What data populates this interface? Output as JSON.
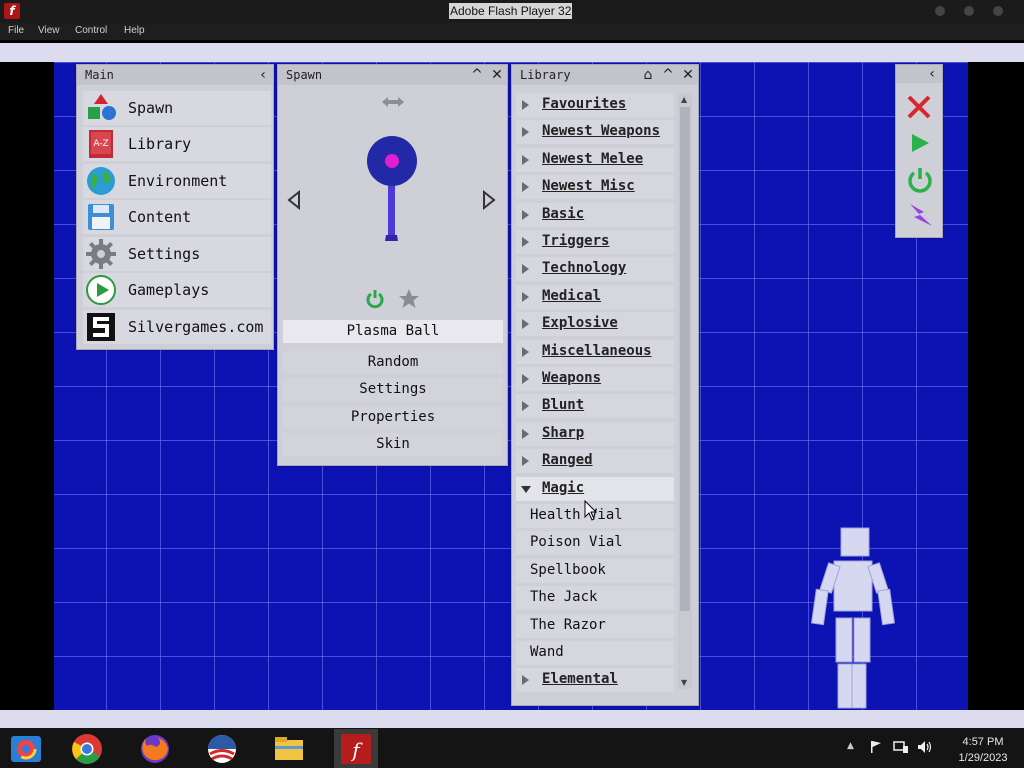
{
  "window": {
    "title": "Adobe Flash Player 32"
  },
  "menubar": [
    "File",
    "View",
    "Control",
    "Help"
  ],
  "main_panel": {
    "title": "Main",
    "items": [
      {
        "label": "Spawn",
        "icon": "shapes-icon"
      },
      {
        "label": "Library",
        "icon": "library-book-icon"
      },
      {
        "label": "Environment",
        "icon": "globe-icon"
      },
      {
        "label": "Content",
        "icon": "floppy-disk-icon"
      },
      {
        "label": "Settings",
        "icon": "gear-icon"
      },
      {
        "label": "Gameplays",
        "icon": "play-icon"
      },
      {
        "label": "Silvergames.com",
        "icon": "silvergames-logo-icon"
      }
    ]
  },
  "spawn_panel": {
    "title": "Spawn",
    "selected_item": "Plasma Ball",
    "buttons": [
      "Random",
      "Settings",
      "Properties",
      "Skin"
    ]
  },
  "library_panel": {
    "title": "Library",
    "categories": [
      "Favourites",
      "Newest Weapons",
      "Newest Melee",
      "Newest Misc",
      "Basic",
      "Triggers",
      "Technology",
      "Medical",
      "Explosive",
      "Miscellaneous",
      "Weapons",
      "Blunt",
      "Sharp",
      "Ranged"
    ],
    "open_category": "Magic",
    "open_items": [
      "Health Vial",
      "Poison Vial",
      "Spellbook",
      "The Jack",
      "The Razor",
      "Wand"
    ],
    "after_category": "Elemental"
  },
  "toolbar": {
    "icons": [
      "close-x-icon",
      "play-icon",
      "power-icon",
      "lightning-icon"
    ]
  },
  "taskbar": {
    "apps": [
      "chrome-remote-icon",
      "chrome-icon",
      "firefox-icon",
      "obama-logo-icon",
      "file-explorer-icon",
      "flash-player-icon"
    ],
    "time": "4:57 PM",
    "date": "1/29/2023"
  },
  "colors": {
    "stage_blue": "#0d12b3",
    "panel_gray": "#cfcfd8",
    "accent_magenta": "#e020d0"
  }
}
